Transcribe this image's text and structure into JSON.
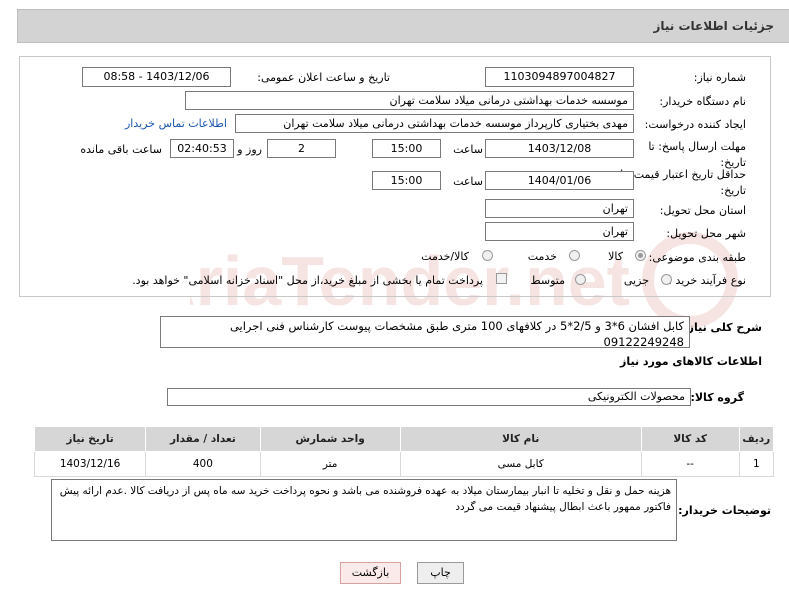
{
  "header": {
    "title": "جزئیات اطلاعات نیاز"
  },
  "form": {
    "need_number_label": "شماره نیاز:",
    "need_number": "1103094897004827",
    "announce_label": "تاریخ و ساعت اعلان عمومی:",
    "announce_value": "1403/12/06 - 08:58",
    "buyer_org_label": "نام دستگاه خریدار:",
    "buyer_org": "موسسه خدمات بهداشتی درمانی میلاد سلامت تهران",
    "requester_label": "ایجاد کننده درخواست:",
    "requester": "مهدی بختیاری کارپرداز موسسه خدمات بهداشتی درمانی میلاد سلامت تهران",
    "contact_link": "اطلاعات تماس خریدار",
    "deadline_label": "مهلت ارسال پاسخ: تا تاریخ:",
    "deadline_date": "1403/12/08",
    "time_label": "ساعت",
    "deadline_time": "15:00",
    "days_value": "2",
    "days_label": "روز و",
    "remaining_time": "02:40:53",
    "remaining_label": "ساعت باقی مانده",
    "validity_label": "حداقل تاریخ اعتبار قیمت: تا تاریخ:",
    "validity_date": "1404/01/06",
    "validity_time": "15:00",
    "province_label": "استان محل تحویل:",
    "province": "تهران",
    "city_label": "شهر محل تحویل:",
    "city": "تهران",
    "category_label": "طبقه بندی موضوعی:",
    "category_options": [
      "کالا",
      "خدمت",
      "کالا/خدمت"
    ],
    "process_label": "نوع فرآیند خرید :",
    "process_options": [
      "جزیی",
      "متوسط"
    ],
    "payment_note": "پرداخت تمام یا بخشی از مبلغ خرید،از محل \"اسناد خزانه اسلامی\" خواهد بود."
  },
  "description": {
    "label": "شرح کلی نیاز:",
    "text": "کابل افشان 6*3 و 2/5*5 در کلافهای 100 متری طبق مشخصات پیوست کارشناس فنی اجرایی 09122249248"
  },
  "goods": {
    "section_title": "اطلاعات کالاهای مورد نیاز",
    "group_label": "گروه کالا:",
    "group_value": "محصولات الکترونیکی",
    "columns": [
      "ردیف",
      "کد کالا",
      "نام کالا",
      "واحد شمارش",
      "تعداد / مقدار",
      "تاریخ نیاز"
    ],
    "rows": [
      {
        "row": "1",
        "code": "--",
        "name": "کابل مسی",
        "unit": "متر",
        "qty": "400",
        "date": "1403/12/16"
      }
    ]
  },
  "buyer_notes": {
    "label": "توضیحات خریدار:",
    "text": "هزینه حمل و نقل و تخلیه تا انبار بیمارستان میلاد به عهده فروشنده می باشد و نحوه پرداخت خرید سه ماه پس از دریافت کالا .عدم ارائه پیش فاکتور ممهور باعث ابطال پیشنهاد قیمت می گردد"
  },
  "buttons": {
    "print": "چاپ",
    "back": "بازگشت"
  },
  "watermark": {
    "text": "AriaTender.net",
    "color": "#c0392b"
  }
}
